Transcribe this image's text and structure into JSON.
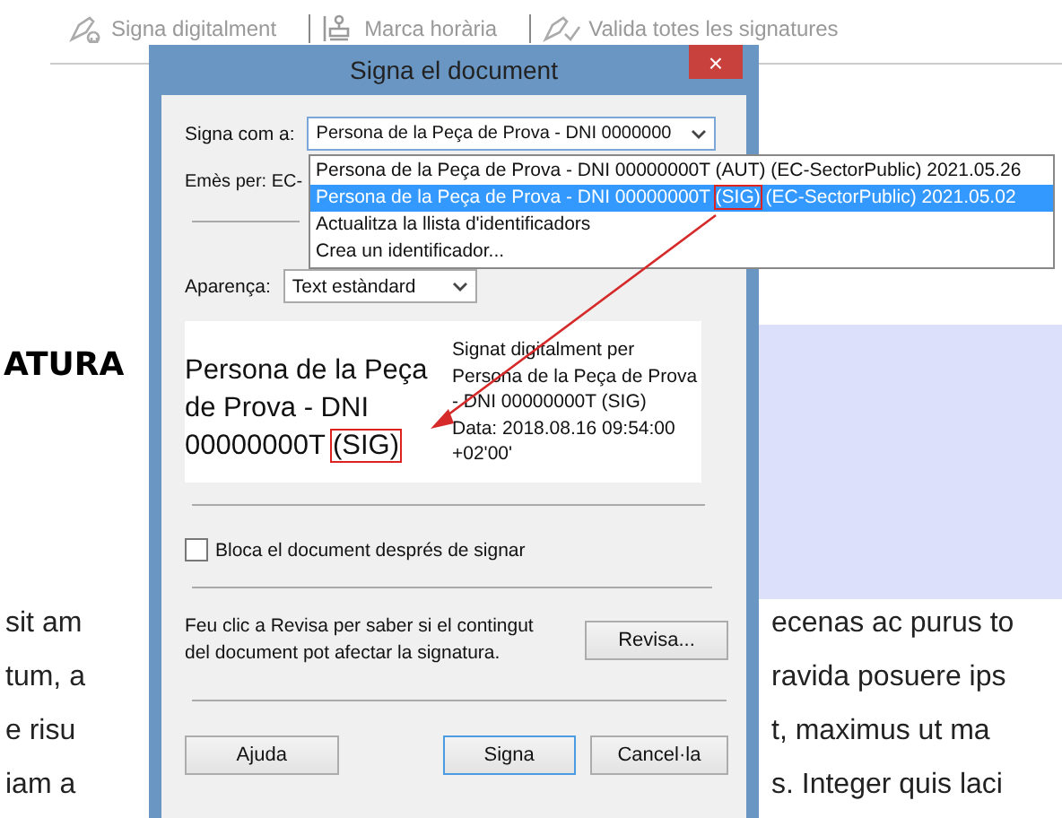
{
  "toolbar": {
    "items": [
      {
        "label": "Signa digitalment"
      },
      {
        "label": "Marca horària"
      },
      {
        "label": "Valida totes les signatures"
      }
    ]
  },
  "page": {
    "heading": "ATURA",
    "lines": [
      {
        "left": "sit am",
        "right": "ecenas ac purus to"
      },
      {
        "left": "tum, a",
        "right": "ravida posuere ips"
      },
      {
        "left": "e risu",
        "right": "t, maximus ut ma"
      },
      {
        "left": "iam a",
        "right": "s. Integer quis laci"
      }
    ]
  },
  "dialog": {
    "title": "Signa el document",
    "close": "×",
    "sign_as_label": "Signa com a:",
    "sign_as_value": "Persona de la Peça de Prova - DNI 0000000",
    "dropdown": [
      {
        "selected": false,
        "parts": [
          {
            "text": "Persona de la Peça de Prova - DNI 00000000T (AUT) (EC-SectorPublic) 2021.05.26",
            "annotated": false
          }
        ]
      },
      {
        "selected": true,
        "parts": [
          {
            "text": "Persona de la Peça de Prova - DNI 00000000T ",
            "annotated": false
          },
          {
            "text": "(SIG)",
            "annotated": true
          },
          {
            "text": " (EC-SectorPublic) 2021.05.02",
            "annotated": false
          }
        ]
      },
      {
        "selected": false,
        "parts": [
          {
            "text": "Actualitza la llista d'identificadors",
            "annotated": false
          }
        ]
      },
      {
        "selected": false,
        "parts": [
          {
            "text": "Crea un identificador...",
            "annotated": false
          }
        ]
      }
    ],
    "issued_by": "Emès per: EC-",
    "appearance_label": "Aparença:",
    "appearance_value": "Text estàndard",
    "preview": {
      "name_parts": [
        {
          "text": "Persona de la Peça de Prova - DNI 00000000T ",
          "annotated": false
        },
        {
          "text": "(SIG)",
          "annotated": true
        }
      ],
      "details": [
        "Signat digitalment per",
        "Persona de la Peça de Prova",
        "- DNI 00000000T (SIG)",
        "Data: 2018.08.16 09:54:00",
        "+02'00'"
      ]
    },
    "lock": {
      "label": "Bloca el document després de signar",
      "checked": false
    },
    "review_text": "Feu clic a Revisa per saber si el contingut del document pot afectar la signatura.",
    "review_button": "Revisa...",
    "buttons": [
      {
        "label": "Ajuda",
        "default": false
      },
      {
        "label": "Signa",
        "default": true
      },
      {
        "label": "Cancel·la",
        "default": false
      }
    ]
  }
}
